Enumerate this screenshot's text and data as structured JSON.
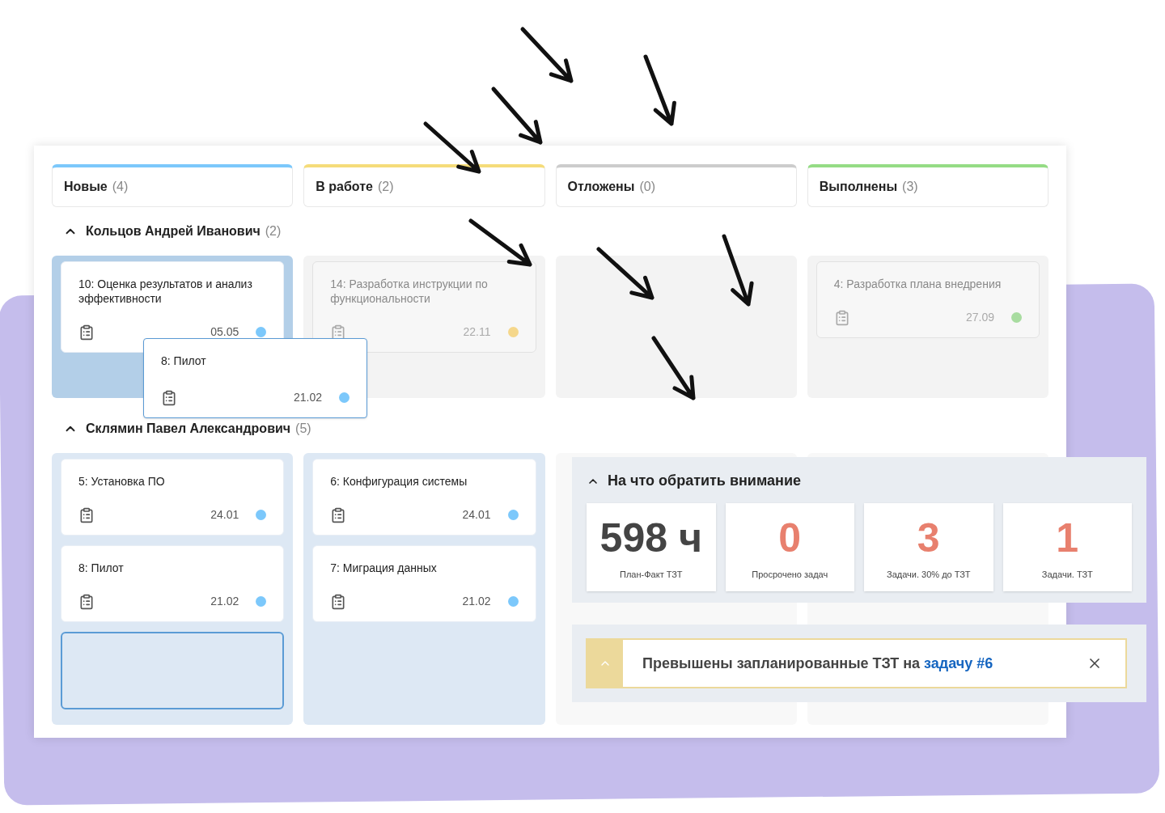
{
  "columns": [
    {
      "title": "Новые",
      "count": "(4)",
      "color": "#7cc8fb"
    },
    {
      "title": "В работе",
      "count": "(2)",
      "color": "#f5dc7a"
    },
    {
      "title": "Отложены",
      "count": "(0)",
      "color": "#cccccc"
    },
    {
      "title": "Выполнены",
      "count": "(3)",
      "color": "#95dc85"
    }
  ],
  "groups": [
    {
      "name": "Кольцов Андрей Иванович",
      "count": "(2)",
      "expanded": true,
      "lanes": [
        {
          "kind": "target",
          "cards": [
            {
              "title": "10: Оценка результатов и анализ эффективности",
              "date": "05.05",
              "color": "#7cc8fb",
              "disabled": false
            }
          ]
        },
        {
          "kind": "blocked",
          "cards": [
            {
              "title": "14: Разработка инструкции по функциональности",
              "date": "22.11",
              "color": "#f5d78b",
              "disabled": true
            }
          ]
        },
        {
          "kind": "blocked"
        },
        {
          "kind": "blocked",
          "cards": [
            {
              "title": "4: Разработка плана внедрения",
              "date": "27.09",
              "color": "#a8dca0",
              "disabled": true
            }
          ]
        }
      ]
    },
    {
      "name": "Склямин Павел Александрович",
      "count": "(5)",
      "expanded": true,
      "lanes": [
        {
          "kind": "open",
          "placeholder": true,
          "cards": [
            {
              "title": "5: Установка ПО",
              "date": "24.01",
              "color": "#7cc8fb",
              "disabled": false
            },
            {
              "title": "8: Пилот",
              "date": "21.02",
              "color": "#7cc8fb",
              "disabled": false
            }
          ]
        },
        {
          "kind": "open",
          "cards": [
            {
              "title": "6: Конфигурация системы",
              "date": "24.01",
              "color": "#7cc8fb",
              "disabled": false
            },
            {
              "title": "7: Миграция данных",
              "date": "21.02",
              "color": "#7cc8fb",
              "disabled": false
            }
          ]
        },
        {
          "kind": "idle"
        },
        {
          "kind": "idle"
        }
      ]
    }
  ],
  "dragged_card": {
    "title": "8: Пилот",
    "date": "21.02",
    "color": "#7cc8fb"
  },
  "attention": {
    "title": "На что обратить внимание",
    "expanded": true,
    "metrics": [
      {
        "value": "598 ч",
        "label": "План-Факт ТЗТ",
        "kind": "neutral"
      },
      {
        "value": "0",
        "label": "Просрочено задач",
        "kind": "alert"
      },
      {
        "value": "3",
        "label": "Задачи. 30% до ТЗТ",
        "kind": "alert"
      },
      {
        "value": "1",
        "label": "Задачи. ТЗТ",
        "kind": "alert"
      }
    ]
  },
  "alert": {
    "message": "Превышены запланированные ТЗТ на",
    "link": "задачу #6",
    "expanded": false
  }
}
